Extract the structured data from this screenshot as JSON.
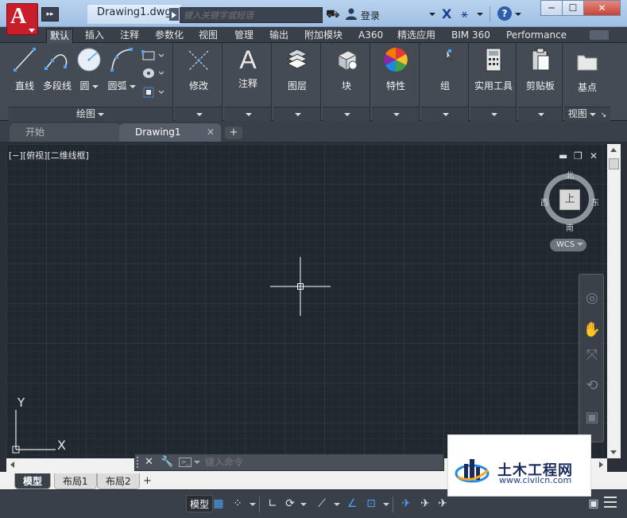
{
  "titlebar": {
    "app_letter": "A",
    "qa_label": "▸▸",
    "document_title": "Drawing1.dwg",
    "search_placeholder": "键入关键字或短语",
    "login_label": "登录",
    "help_label": "?",
    "min_label": "─",
    "max_label": "☐",
    "close_label": "✕"
  },
  "ribbon_tabs": [
    {
      "label": "默认",
      "active": true
    },
    {
      "label": "插入"
    },
    {
      "label": "注释"
    },
    {
      "label": "参数化"
    },
    {
      "label": "视图"
    },
    {
      "label": "管理"
    },
    {
      "label": "输出"
    },
    {
      "label": "附加模块"
    },
    {
      "label": "A360"
    },
    {
      "label": "精选应用"
    },
    {
      "label": "BIM 360"
    },
    {
      "label": "Performance"
    }
  ],
  "ribbon": {
    "draw_panel": {
      "title": "绘图",
      "tools": [
        "直线",
        "多段线",
        "圆",
        "圆弧"
      ]
    },
    "modify": "修改",
    "annotate": "注释",
    "layers": "图层",
    "block": "块",
    "properties": "特性",
    "group": "组",
    "utilities": "实用工具",
    "clipboard": "剪贴板",
    "base_point": "基点",
    "view_panel_title": "视图"
  },
  "doc_tabs": {
    "start": "开始",
    "drawing": "Drawing1",
    "close": "✕",
    "plus": "+"
  },
  "viewport": {
    "label": "[−][俯视][二维线框]",
    "min": "▬",
    "restore": "❐",
    "close": "✕"
  },
  "viewcube": {
    "north": "北",
    "south": "南",
    "east": "东",
    "west": "西",
    "face": "上",
    "wcs": "WCS"
  },
  "ucs": {
    "x": "X",
    "y": "Y"
  },
  "command_line": {
    "close": "✕",
    "placeholder": "键入命令"
  },
  "layout_tabs": [
    {
      "label": "模型",
      "active": true
    },
    {
      "label": "布局1"
    },
    {
      "label": "布局2"
    }
  ],
  "layout_plus": "+",
  "statusbar": {
    "model": "模型"
  },
  "watermark": {
    "title": "土木工程网",
    "url": "www.civilcn.com"
  },
  "colors": {
    "app_red": "#c81d2a",
    "ribbon_bg": "#454b55",
    "canvas_bg": "#212830",
    "accent_blue": "#4ba3f4"
  }
}
